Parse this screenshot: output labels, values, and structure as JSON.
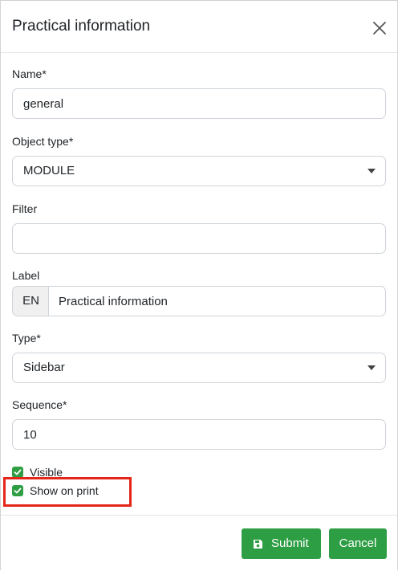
{
  "dialog": {
    "title": "Practical information"
  },
  "fields": {
    "name": {
      "label": "Name*",
      "value": "general"
    },
    "object_type": {
      "label": "Object type*",
      "value": "MODULE"
    },
    "filter": {
      "label": "Filter",
      "value": ""
    },
    "label": {
      "label": "Label",
      "lang": "EN",
      "value": "Practical information"
    },
    "type": {
      "label": "Type*",
      "value": "Sidebar"
    },
    "sequence": {
      "label": "Sequence*",
      "value": "10"
    }
  },
  "checkboxes": {
    "visible": {
      "label": "Visible",
      "checked": true
    },
    "show_on_print": {
      "label": "Show on print",
      "checked": true
    }
  },
  "footer": {
    "submit_label": "Submit",
    "cancel_label": "Cancel"
  },
  "colors": {
    "accent": "#2e9e44",
    "highlight": "#e5261b"
  },
  "icons": {
    "close": "close-icon",
    "save": "save-icon",
    "caret": "chevron-down-icon",
    "check": "check-icon"
  }
}
